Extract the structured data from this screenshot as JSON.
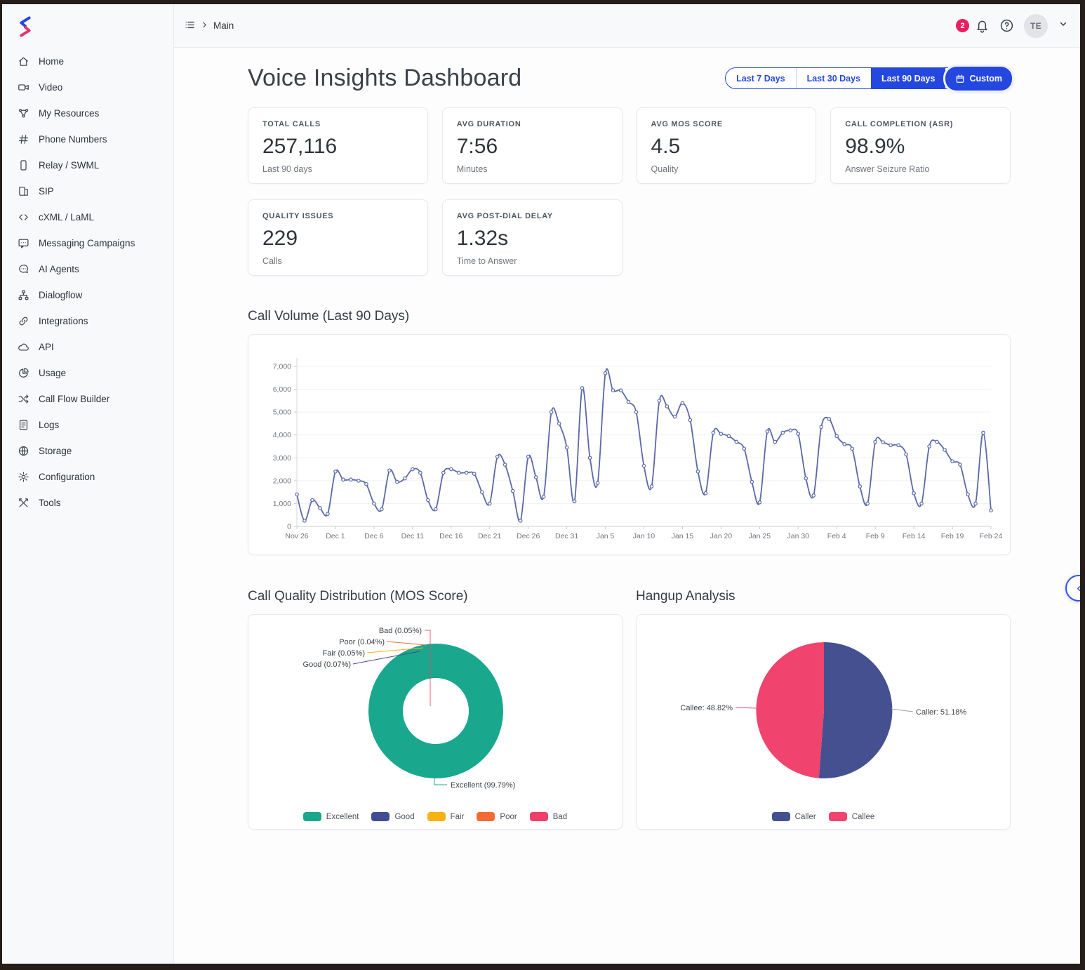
{
  "topbar": {
    "breadcrumb": "Main",
    "notification_count": "2",
    "avatar_initials": "TE"
  },
  "sidebar": {
    "items": [
      {
        "label": "Home",
        "icon": "home"
      },
      {
        "label": "Video",
        "icon": "video"
      },
      {
        "label": "My Resources",
        "icon": "resources"
      },
      {
        "label": "Phone Numbers",
        "icon": "hash"
      },
      {
        "label": "Relay / SWML",
        "icon": "phone"
      },
      {
        "label": "SIP",
        "icon": "book"
      },
      {
        "label": "cXML / LaML",
        "icon": "code"
      },
      {
        "label": "Messaging Campaigns",
        "icon": "chat-square"
      },
      {
        "label": "AI Agents",
        "icon": "chat-round"
      },
      {
        "label": "Dialogflow",
        "icon": "sitemap"
      },
      {
        "label": "Integrations",
        "icon": "link"
      },
      {
        "label": "API",
        "icon": "cloud"
      },
      {
        "label": "Usage",
        "icon": "pie"
      },
      {
        "label": "Call Flow Builder",
        "icon": "shuffle"
      },
      {
        "label": "Logs",
        "icon": "file"
      },
      {
        "label": "Storage",
        "icon": "globe"
      },
      {
        "label": "Configuration",
        "icon": "gear"
      },
      {
        "label": "Tools",
        "icon": "tools"
      }
    ]
  },
  "header": {
    "title": "Voice Insights Dashboard",
    "ranges": [
      {
        "label": "Last 7 Days",
        "active": false
      },
      {
        "label": "Last 30 Days",
        "active": false
      },
      {
        "label": "Last 90 Days",
        "active": true
      },
      {
        "label": "Custom",
        "active": true,
        "icon": "calendar"
      }
    ]
  },
  "stats": [
    {
      "label": "TOTAL CALLS",
      "value": "257,116",
      "sub": "Last 90 days"
    },
    {
      "label": "AVG DURATION",
      "value": "7:56",
      "sub": "Minutes"
    },
    {
      "label": "AVG MOS SCORE",
      "value": "4.5",
      "sub": "Quality"
    },
    {
      "label": "CALL COMPLETION (ASR)",
      "value": "98.9%",
      "sub": "Answer Seizure Ratio"
    },
    {
      "label": "QUALITY ISSUES",
      "value": "229",
      "sub": "Calls"
    },
    {
      "label": "AVG POST-DIAL DELAY",
      "value": "1.32s",
      "sub": "Time to Answer"
    }
  ],
  "colors": {
    "accent_blue": "#2447e0",
    "badge_pink": "#e91e5f",
    "line": "#5a68a8",
    "excellent_teal": "#19a88e",
    "good_indigo": "#3f4d92",
    "fair_amber": "#f9b115",
    "poor_orange": "#f26b35",
    "bad_pink": "#ef3e68",
    "caller_indigo": "#44508f",
    "callee_pink": "#f0436e"
  },
  "chart_data": [
    {
      "type": "line",
      "title": "Call Volume (Last 90 Days)",
      "xlabel": "",
      "ylabel": "",
      "ylim": [
        0,
        7000
      ],
      "ytick_step": 1000,
      "xtick_every": 5,
      "grid": true,
      "line_color": "#5a68a8",
      "x": [
        "Nov 26",
        "Nov 27",
        "Nov 28",
        "Nov 29",
        "Nov 30",
        "Dec 1",
        "Dec 2",
        "Dec 3",
        "Dec 4",
        "Dec 5",
        "Dec 6",
        "Dec 7",
        "Dec 8",
        "Dec 9",
        "Dec 10",
        "Dec 11",
        "Dec 12",
        "Dec 13",
        "Dec 14",
        "Dec 15",
        "Dec 16",
        "Dec 17",
        "Dec 18",
        "Dec 19",
        "Dec 20",
        "Dec 21",
        "Dec 22",
        "Dec 23",
        "Dec 24",
        "Dec 25",
        "Dec 26",
        "Dec 27",
        "Dec 28",
        "Dec 29",
        "Dec 30",
        "Dec 31",
        "Jan 1",
        "Jan 2",
        "Jan 3",
        "Jan 4",
        "Jan 5",
        "Jan 6",
        "Jan 7",
        "Jan 8",
        "Jan 9",
        "Jan 10",
        "Jan 11",
        "Jan 12",
        "Jan 13",
        "Jan 14",
        "Jan 15",
        "Jan 16",
        "Jan 17",
        "Jan 18",
        "Jan 19",
        "Jan 20",
        "Jan 21",
        "Jan 22",
        "Jan 23",
        "Jan 24",
        "Jan 25",
        "Jan 26",
        "Jan 27",
        "Jan 28",
        "Jan 29",
        "Jan 30",
        "Jan 31",
        "Feb 1",
        "Feb 2",
        "Feb 3",
        "Feb 4",
        "Feb 5",
        "Feb 6",
        "Feb 7",
        "Feb 8",
        "Feb 9",
        "Feb 10",
        "Feb 11",
        "Feb 12",
        "Feb 13",
        "Feb 14",
        "Feb 15",
        "Feb 16",
        "Feb 17",
        "Feb 18",
        "Feb 19",
        "Feb 20",
        "Feb 21",
        "Feb 22",
        "Feb 23",
        "Feb 24"
      ],
      "values": [
        1400,
        250,
        1150,
        800,
        550,
        2400,
        2050,
        2050,
        2000,
        1850,
        1000,
        750,
        2450,
        1950,
        2100,
        2500,
        2350,
        1150,
        750,
        2350,
        2500,
        2350,
        2350,
        2300,
        1500,
        1000,
        3050,
        2700,
        1550,
        250,
        3050,
        2150,
        1300,
        5000,
        4500,
        3450,
        1100,
        6050,
        3000,
        1900,
        6700,
        5950,
        5950,
        5450,
        5000,
        2650,
        1750,
        5500,
        5250,
        4800,
        5400,
        4650,
        2400,
        1450,
        4100,
        4050,
        3950,
        3700,
        3400,
        1950,
        1050,
        4150,
        3700,
        4100,
        4200,
        4050,
        2100,
        1350,
        4350,
        4700,
        3950,
        3600,
        3400,
        1750,
        1000,
        3700,
        3680,
        3550,
        3550,
        3150,
        1450,
        1000,
        3500,
        3700,
        3350,
        2850,
        2700,
        1400,
        1000,
        4100,
        700
      ]
    },
    {
      "type": "pie",
      "subtype": "donut",
      "title": "Call Quality Distribution (MOS Score)",
      "labels": [
        "Excellent",
        "Good",
        "Fair",
        "Poor",
        "Bad"
      ],
      "values": [
        99.79,
        0.07,
        0.05,
        0.04,
        0.05
      ],
      "colors": [
        "#19a88e",
        "#3f4d92",
        "#f9b115",
        "#f26b35",
        "#ef3e68"
      ],
      "callouts": {
        "bad": "Bad (0.05%)",
        "poor": "Poor (0.04%)",
        "fair": "Fair (0.05%)",
        "good": "Good (0.07%)",
        "excellent": "Excellent (99.79%)"
      },
      "legend_position": "bottom"
    },
    {
      "type": "pie",
      "title": "Hangup Analysis",
      "labels": [
        "Caller",
        "Callee"
      ],
      "values": [
        51.18,
        48.82
      ],
      "colors": [
        "#44508f",
        "#f0436e"
      ],
      "callouts": {
        "caller": "Caller: 51.18%",
        "callee": "Callee: 48.82%"
      },
      "legend_position": "bottom"
    }
  ]
}
